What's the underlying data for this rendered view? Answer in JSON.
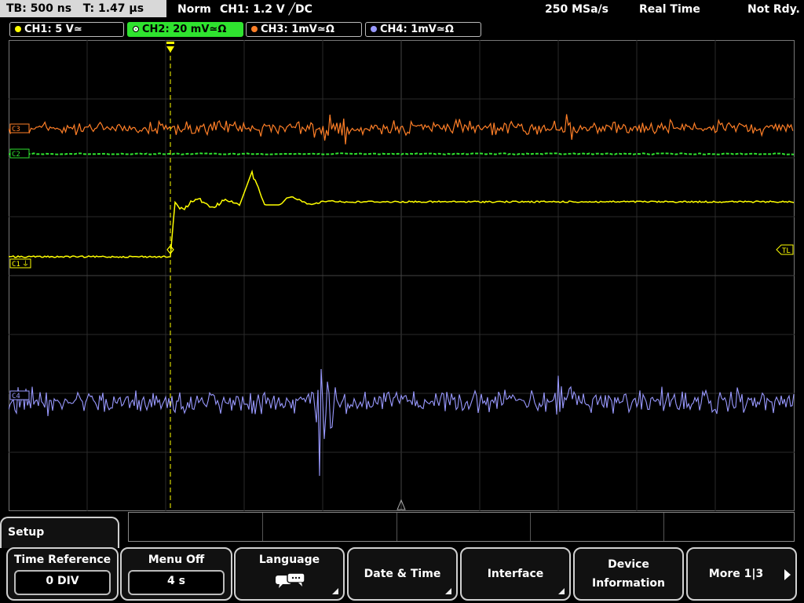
{
  "status": {
    "timebase": "TB: 500 ns",
    "trigger_time": "T: 1.47 µs",
    "mode": "Norm",
    "trigger": "CH1: 1.2 V ╱DC",
    "sample_rate": "250 MSa/s",
    "acquisition": "Real Time",
    "ready_state": "Not Rdy."
  },
  "channels": [
    {
      "label": "CH1: 5 V≃",
      "color": "#ffff00",
      "active": false
    },
    {
      "label": "CH2: 20 mV≃Ω",
      "color": "#2fe32f",
      "active": true
    },
    {
      "label": "CH3: 1mV≃Ω",
      "color": "#ff7f27",
      "active": false
    },
    {
      "label": "CH4: 1mV≃Ω",
      "color": "#9999ff",
      "active": false
    }
  ],
  "markers": {
    "trigger_level": "TL",
    "ch1": "C1",
    "ch2": "C2",
    "ch3": "C3",
    "ch4": "C4"
  },
  "menu": {
    "title": "Setup",
    "time_reference": {
      "label": "Time Reference",
      "value": "0 DIV"
    },
    "menu_off": {
      "label": "Menu Off",
      "value": "4 s"
    },
    "language": {
      "label": "Language"
    },
    "date_time": {
      "label": "Date & Time"
    },
    "interface": {
      "label": "Interface"
    },
    "device_info": {
      "label1": "Device",
      "label2": "Information"
    },
    "more": {
      "label": "More 1|3"
    }
  },
  "icons": [
    "speech-bubble-icon",
    "corner-arrow-icon",
    "right-arrow-icon",
    "trigger-marker-icon",
    "ground-symbol-icon"
  ]
}
